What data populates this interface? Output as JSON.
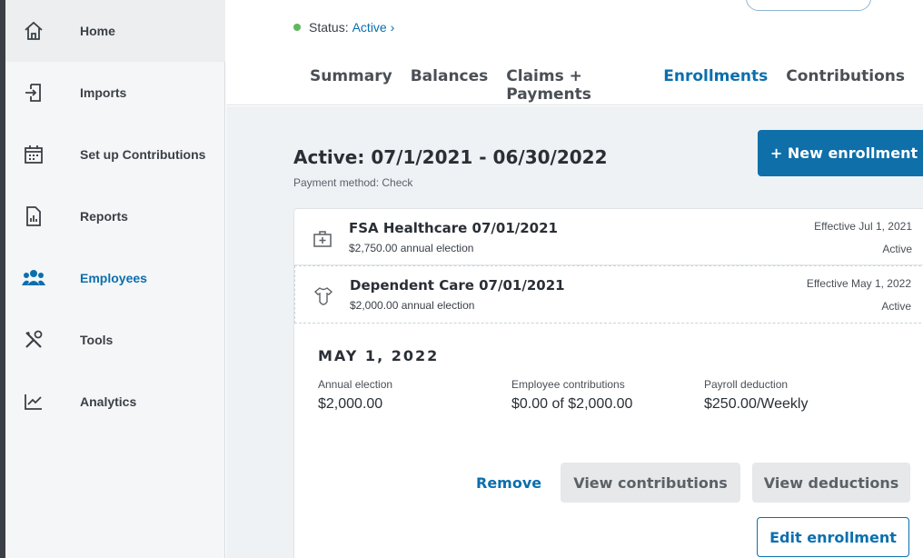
{
  "sidebar": {
    "items": [
      {
        "label": "Home",
        "icon": "home-icon"
      },
      {
        "label": "Imports",
        "icon": "import-icon"
      },
      {
        "label": "Set up Contributions",
        "icon": "calendar-icon"
      },
      {
        "label": "Reports",
        "icon": "report-icon"
      },
      {
        "label": "Employees",
        "icon": "people-icon"
      },
      {
        "label": "Tools",
        "icon": "tools-icon"
      },
      {
        "label": "Analytics",
        "icon": "analytics-icon"
      }
    ]
  },
  "header": {
    "status_label": "Status:",
    "status_value": "Active ›",
    "tabs": [
      "Summary",
      "Balances",
      "Claims + Payments",
      "Enrollments",
      "Contributions"
    ],
    "selected_tab": "Enrollments"
  },
  "main": {
    "period_title": "Active: 07/1/2021 - 06/30/2022",
    "payment_method": "Payment method: Check",
    "new_enrollment_label": "+ New enrollment",
    "enrollments": [
      {
        "name": "FSA Healthcare 07/01/2021",
        "election": "$2,750.00 annual election",
        "effective": "Effective Jul 1, 2021",
        "status": "Active",
        "icon": "medical-kit-icon"
      },
      {
        "name": "Dependent Care 07/01/2021",
        "election": "$2,000.00 annual election",
        "effective": "Effective May 1, 2022",
        "status": "Active",
        "icon": "onesie-icon"
      }
    ],
    "detail": {
      "date": "MAY 1, 2022",
      "annual_election_label": "Annual election",
      "annual_election_value": "$2,000.00",
      "employee_contrib_label": "Employee contributions",
      "employee_contrib_value": "$0.00 of $2,000.00",
      "payroll_label": "Payroll deduction",
      "payroll_value": "$250.00/Weekly"
    },
    "actions": {
      "remove": "Remove",
      "view_contributions": "View contributions",
      "view_deductions": "View deductions",
      "edit_enrollment": "Edit enrollment"
    }
  },
  "colors": {
    "accent": "#0b6fae",
    "button": "#0e6fa9",
    "status_dot": "#5cb85c"
  }
}
